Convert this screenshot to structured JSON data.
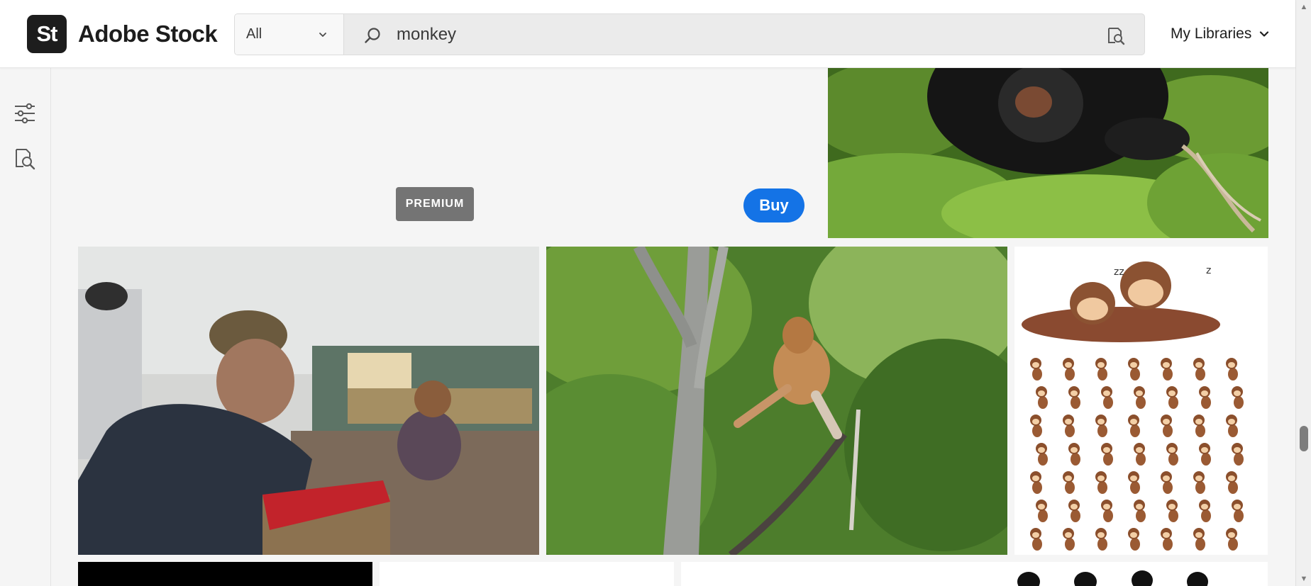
{
  "header": {
    "logo_text": "St",
    "brand_name": "Adobe Stock",
    "search_scope": "All",
    "search_value": "monkey",
    "libraries_label": "My Libraries"
  },
  "rail": {
    "items": [
      {
        "icon": "filters-icon"
      },
      {
        "icon": "visual-search-icon"
      }
    ]
  },
  "results": {
    "badge_label": "PREMIUM",
    "buy_label": "Buy",
    "tiles": [
      {
        "subject": "chimpanzee in green bushes"
      },
      {
        "subject": "old man with monkey at market"
      },
      {
        "subject": "proboscis monkey on tree"
      },
      {
        "subject": "cartoon monkeys set"
      },
      {
        "subject": "black image"
      },
      {
        "subject": "white image"
      },
      {
        "subject": "monkey silhouettes"
      }
    ]
  },
  "colors": {
    "accent": "#1473e6",
    "badge": "#747474",
    "brand_dark": "#1d1d1d"
  }
}
